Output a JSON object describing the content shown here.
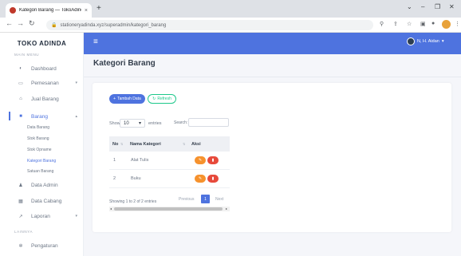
{
  "browser": {
    "tab_title": "Kategori Barang — TokoAdinda",
    "url": "stationeryadinda.xyz/superadmin/kategori_barang",
    "new_tab": "+",
    "close_tab": "×"
  },
  "sidebar": {
    "brand": "TOKO ADINDA",
    "section_main": "MAIN MENU",
    "section_lainnya": "LAINNYA",
    "items": [
      {
        "label": "Dashboard",
        "icon": "gauge-icon"
      },
      {
        "label": "Pemesanan",
        "icon": "monitor-icon"
      },
      {
        "label": "Jual Barang",
        "icon": "store-icon"
      },
      {
        "label": "Barang",
        "icon": "box-icon"
      },
      {
        "label": "Data Admin",
        "icon": "user-icon"
      },
      {
        "label": "Data Cabang",
        "icon": "building-icon"
      },
      {
        "label": "Laporan",
        "icon": "chart-icon"
      },
      {
        "label": "Pengaturan",
        "icon": "gear-icon"
      }
    ],
    "sub_items": [
      "Data Barang",
      "Stok Barang",
      "Stok Opname",
      "Kategori Barang",
      "Satuan Barang"
    ]
  },
  "topbar": {
    "user_name": "N, H. Aidan"
  },
  "page": {
    "title": "Kategori Barang",
    "btn_add": "Tambah Data",
    "btn_refresh": "Refresh",
    "show_label": "Show",
    "entries_value": "10",
    "entries_label": "entries",
    "search_label": "Search:",
    "columns": [
      "No",
      "Nama Kategori",
      "Aksi"
    ],
    "rows": [
      {
        "no": "1",
        "name": "Alat Tulis"
      },
      {
        "no": "2",
        "name": "Buku"
      }
    ],
    "showing": "Showing 1 to 2 of 2 entries",
    "prev": "Previous",
    "page_no": "1",
    "next": "Next"
  }
}
